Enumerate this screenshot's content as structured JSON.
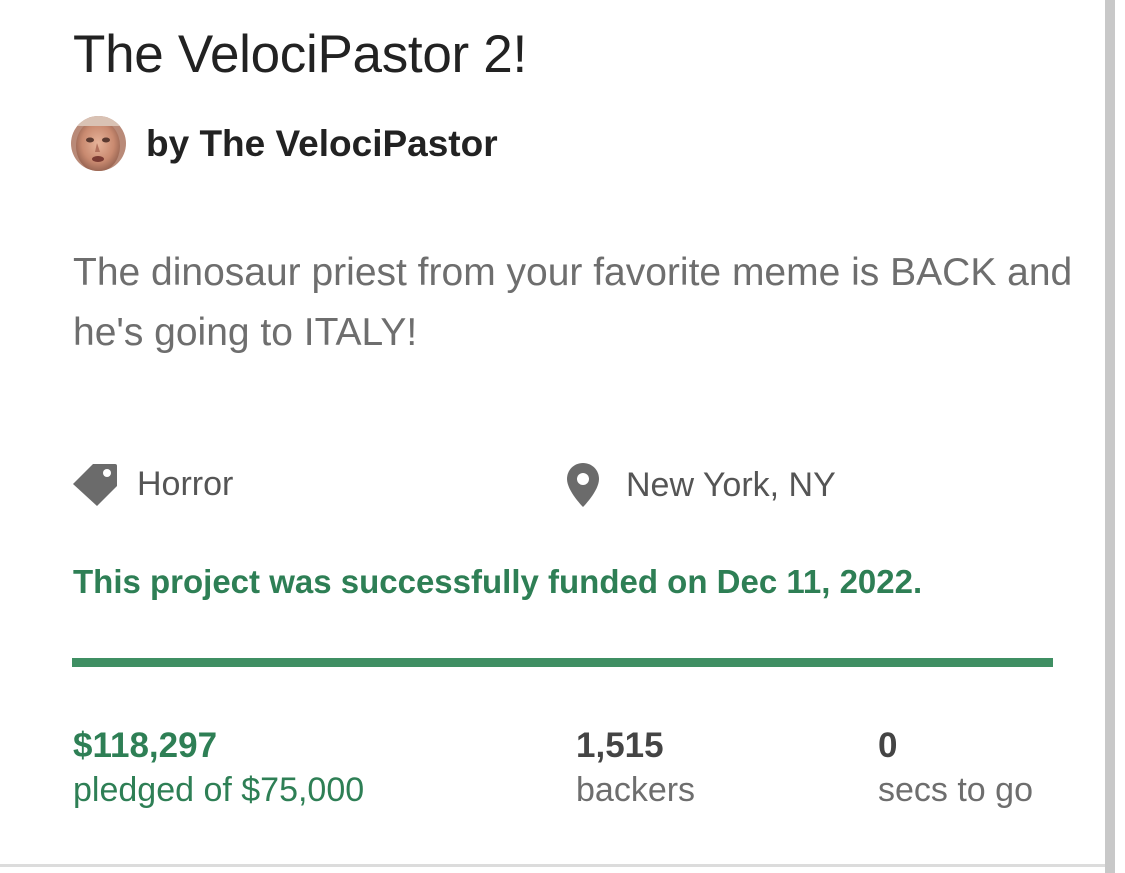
{
  "project": {
    "title": "The VelociPastor 2!",
    "creator_line": "by The VelociPastor",
    "blurb": "The dinosaur priest from your favorite meme is BACK and he's going to ITALY!",
    "category": "Horror",
    "location": "New York, NY",
    "status_message": "This project was successfully funded on Dec 11, 2022."
  },
  "stats": {
    "pledged_amount": "$118,297",
    "pledged_label": "pledged of $75,000",
    "backers_count": "1,515",
    "backers_label": "backers",
    "time_value": "0",
    "time_label": "secs to go"
  },
  "progress": {
    "percent_funded": 100
  },
  "icons": {
    "category": "tag-icon",
    "location": "map-pin-icon"
  },
  "colors": {
    "success_green": "#2e7f55",
    "progress_green": "#3f8f63",
    "title_text": "#222222",
    "body_text": "#6e6e6e",
    "icon_gray": "#6b6b6b"
  }
}
